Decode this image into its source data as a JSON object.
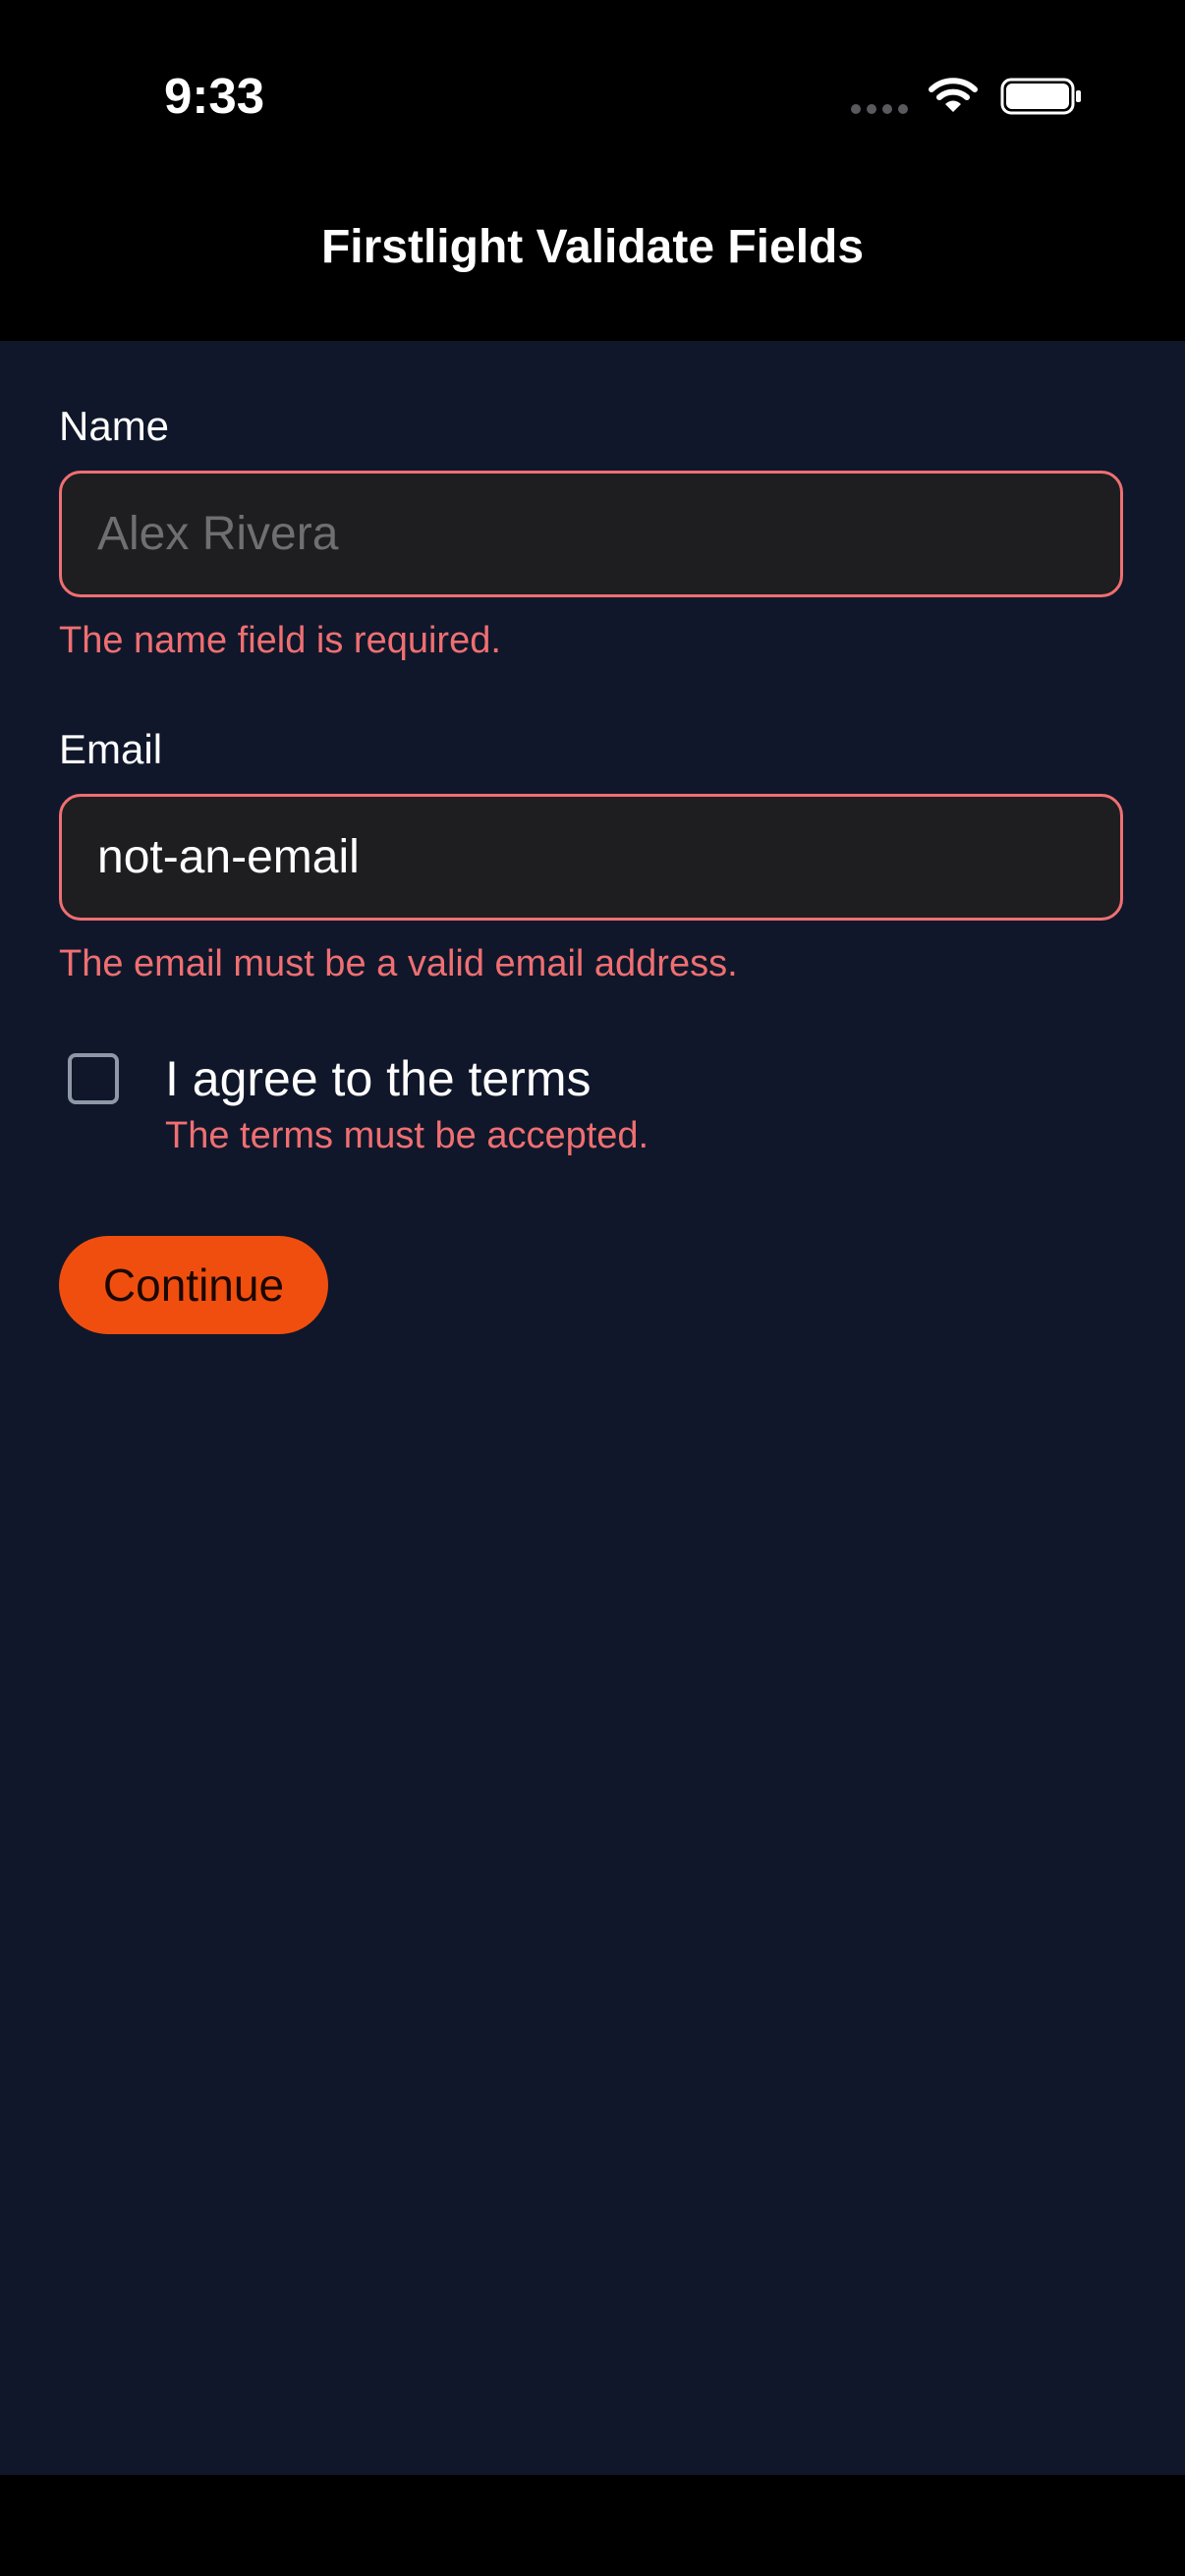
{
  "status_bar": {
    "time": "9:33"
  },
  "nav": {
    "title": "Firstlight Validate Fields"
  },
  "form": {
    "name": {
      "label": "Name",
      "placeholder": "Alex Rivera",
      "value": "",
      "error": "The name field is required."
    },
    "email": {
      "label": "Email",
      "value": "not-an-email",
      "error": "The email must be a valid email address."
    },
    "terms": {
      "label": "I agree to the terms",
      "checked": false,
      "error": "The terms must be accepted."
    },
    "submit_label": "Continue"
  },
  "colors": {
    "background": "#10172a",
    "error": "#ef6f72",
    "accent": "#f04e0f",
    "field_background": "#1e1e20"
  },
  "icons": {
    "signal": "signal-dots-icon",
    "wifi": "wifi-icon",
    "battery": "battery-icon"
  }
}
